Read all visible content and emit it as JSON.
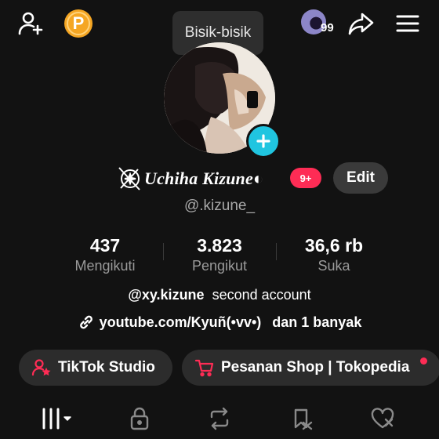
{
  "tooltip": "Bisik-bisik",
  "header": {
    "points_letter": "P",
    "notification_count": "99",
    "icons": [
      "add-friend-icon",
      "points-coin-icon",
      "share-icon",
      "menu-icon"
    ]
  },
  "profile": {
    "display_name": "Uchiha Kizune◐",
    "badge": "9+",
    "edit_label": "Edit",
    "username": "@.kizune_"
  },
  "stats": [
    {
      "value": "437",
      "label": "Mengikuti"
    },
    {
      "value": "3.823",
      "label": "Pengikut"
    },
    {
      "value": "36,6 rb",
      "label": "Suka"
    }
  ],
  "bio": {
    "handle": "@xy.kizune",
    "text": "second account"
  },
  "link": {
    "url": "youtube.com/Kyuñ(•vv•)",
    "more": "dan 1 banyak"
  },
  "buttons": {
    "studio": "TikTok Studio",
    "shop": "Pesanan Shop | Tokopedia"
  },
  "colors": {
    "background": "#121212",
    "accent": "#fe2c55",
    "add_photo": "#20c5e0",
    "points": "#f5a623"
  }
}
